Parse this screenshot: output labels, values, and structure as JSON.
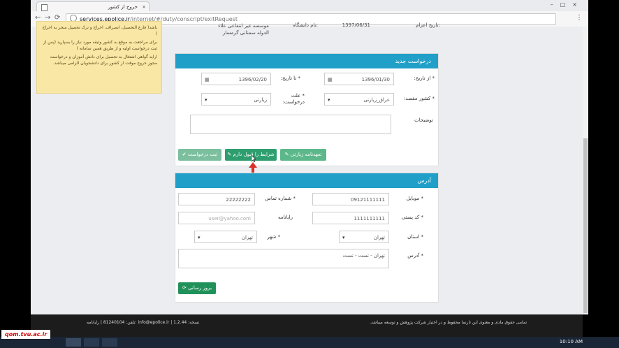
{
  "browser": {
    "tab_title": "خروج از کشور",
    "url_host": "services.epolice.ir",
    "url_path": "/internet/#/duty/conscript/exitRequest"
  },
  "notice": {
    "lines": [
      "باشد( فارغ التحصیل، انصراف، اخراج و ترک تحصیل منجر به اخراج )",
      "برای مراجعت به موقع به کشور وثیقه مورد نیاز را بسپارید (پس از ثبت درخواست اولیه و از طریق همین سامانه )",
      "ارایه گواهی اشتغال به تحصیل برای دانش آموزان و درخواست مجوز خروج موقت از کشور برای دانشجویان الزامی میباشد."
    ]
  },
  "summary": {
    "date_label": "تاریخ اعزام:",
    "date_value": "1397/06/31",
    "university_label": "نام دانشگاه:",
    "university_value": "موسسه غیر انتفاعی علاء الدوله سمنانی گرمسار"
  },
  "request": {
    "title": "درخواست جدید",
    "from_label": "* از تاریخ:",
    "from_value": "1396/01/30",
    "to_label": "* تا تاریخ:",
    "to_value": "1396/02/20",
    "dest_label": "* کشور مقصد:",
    "dest_value": "عراق_زیارتی",
    "reason_label": "* علت درخواست:",
    "reason_value": "زیارتی",
    "desc_label": "توضیحات",
    "btn_submit": "ثبت درخواست",
    "btn_accept": "شرایط را قبول دارم",
    "btn_pledge": "تعهدنامه زیارتی"
  },
  "address": {
    "title": "آدرس",
    "mobile_label": "* موبایل",
    "mobile_value": "09121111111",
    "phone_label": "* شماره تماس",
    "phone_value": "22222222",
    "postal_label": "* کد پستی",
    "postal_value": "1111111111",
    "email_label": "رایانامه",
    "email_value": "user@yahoo.com",
    "province_label": "* استان",
    "province_value": "تهران",
    "city_label": "* شهر",
    "city_value": "تهران",
    "addr_label": "* آدرس",
    "addr_value": "تهران - تست - تست",
    "btn_update": "بروز رسانی"
  },
  "footer": {
    "left": "تلفن: 81240104 | رایانامه: info@epolice.ir | نسخه: 1.2.44",
    "right": "تمامی حقوق مادی و معنوی این تارنما محفوظ و در اختیار شرکت پژوهش و توسعه میباشد."
  },
  "taskbar": {
    "clock": "10:10 AM"
  },
  "watermark": "qom.tvu.ac.ir"
}
